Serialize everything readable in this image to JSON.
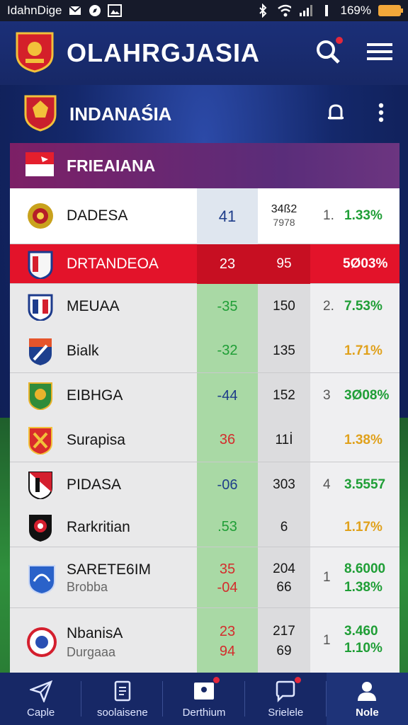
{
  "status": {
    "carrier": "IdahnDige",
    "battery": "169%"
  },
  "app": {
    "title": "OLAHRGJASIA"
  },
  "sub": {
    "title": "INDANAŚIA"
  },
  "group": {
    "title": "FRIEAIANA"
  },
  "rows": [
    {
      "name": "DADESA",
      "a": "41",
      "b_top": "34ß2",
      "b_bot": "7978",
      "rank": "1.",
      "pct": "1.33%"
    },
    {
      "name": "DRTANDEOA",
      "a": "23",
      "b": "95",
      "pct": "5Ø03%"
    },
    {
      "name": "MEUAA",
      "a": "-35",
      "b": "150",
      "rank": "2.",
      "pct": "7.53%"
    },
    {
      "name": "Bialk",
      "a": "-32",
      "b": "135",
      "pct": "1.71%"
    },
    {
      "name": "EIBHGA",
      "a": "-44",
      "b": "152",
      "rank": "3",
      "pct": "3Ø08%"
    },
    {
      "name": "Surapisa",
      "a": "36",
      "b": "11İ",
      "pct": "1.38%"
    },
    {
      "name": "PIDASA",
      "a": "-06",
      "b": "303",
      "rank": "4",
      "pct": "3.5557"
    },
    {
      "name": "Rarkritian",
      "a": ".53",
      "b": "6",
      "pct": "1.17%"
    },
    {
      "name": "SARETE6IM",
      "sub": "Brobba",
      "a_top": "35",
      "a_bot": "-04",
      "b_top": "204",
      "b_bot": "66",
      "rank": "1",
      "pct_top": "8.6000",
      "pct_bot": "1.38%"
    },
    {
      "name": "NbanisA",
      "sub": "Durgaaa",
      "a_top": "23",
      "a_bot": "94",
      "b_top": "217",
      "b_bot": "69",
      "rank": "1",
      "pct_top": "3.460",
      "pct_bot": "1.10%"
    }
  ],
  "nav": [
    {
      "label": "Caple",
      "icon": "paper-plane-icon"
    },
    {
      "label": "soolaisene",
      "icon": "document-icon"
    },
    {
      "label": "Derthium",
      "icon": "inbox-icon"
    },
    {
      "label": "Srielele",
      "icon": "chat-icon"
    },
    {
      "label": "Nole",
      "icon": "profile-icon"
    }
  ]
}
